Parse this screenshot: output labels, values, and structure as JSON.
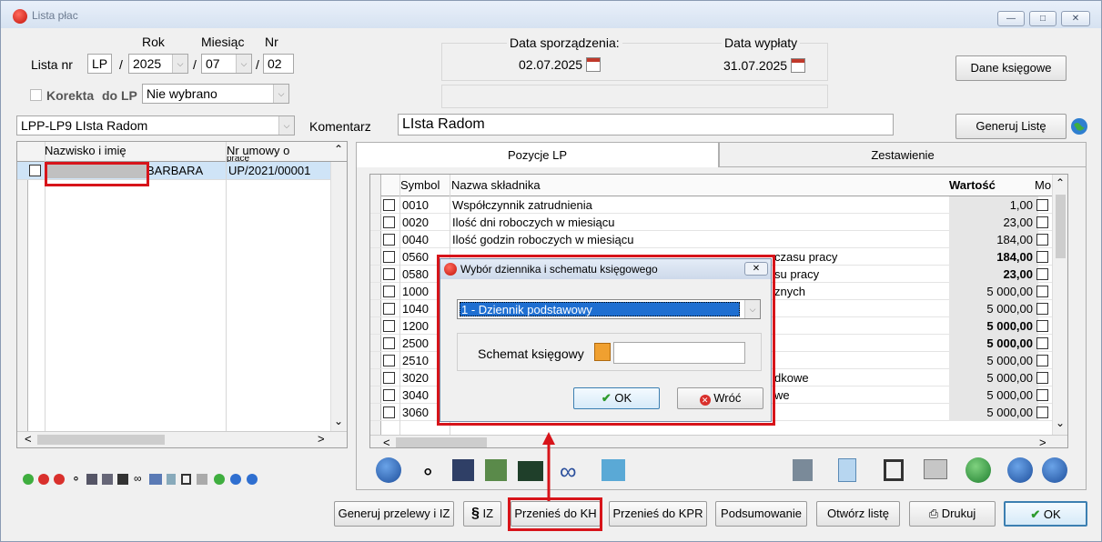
{
  "window": {
    "title": "Lista płac"
  },
  "header": {
    "lista_nr_label": "Lista nr",
    "lp_value": "LP",
    "sep": "/",
    "rok_label": "Rok",
    "rok_value": "2025",
    "miesiac_label": "Miesiąc",
    "miesiac_value": "07",
    "nr_label": "Nr",
    "nr_value": "02",
    "korekta_label": "Korekta",
    "do_lp_label": "do LP",
    "do_lp_value": "Nie wybrano",
    "data_sporzadzenia_label": "Data sporządzenia:",
    "data_sporzadzenia_value": "02.07.2025",
    "data_wyplaty_label": "Data wypłaty",
    "data_wyplaty_value": "31.07.2025",
    "dane_ksiegowe_button": "Dane księgowe",
    "schemat_value": "LPP-LP9 LIsta Radom",
    "komentarz_label": "Komentarz",
    "komentarz_value": "LIsta Radom",
    "generuj_liste_button": "Generuj Listę"
  },
  "left_grid": {
    "col_name": "Nazwisko i imię",
    "col_umowa": "Nr umowy o",
    "col_umowa_2": "pracę",
    "row": {
      "name": "BARBARA",
      "umowa": "UP/2021/00001"
    }
  },
  "tabs": [
    {
      "label": "Pozycje LP"
    },
    {
      "label": "Zestawienie"
    }
  ],
  "right_grid": {
    "col_symbol": "Symbol",
    "col_nazwa": "Nazwa składnika",
    "col_wartosc": "Wartość",
    "col_mo": "Mo",
    "rows": [
      {
        "symbol": "0010",
        "nazwa": "Współczynnik zatrudnienia",
        "wartosc": "1,00",
        "bold": false
      },
      {
        "symbol": "0020",
        "nazwa": "Ilość dni roboczych w miesiącu",
        "wartosc": "23,00",
        "bold": false
      },
      {
        "symbol": "0040",
        "nazwa": "Ilość godzin roboczych w miesiącu",
        "wartosc": "184,00",
        "bold": false
      },
      {
        "symbol": "0560",
        "nazwa": "czasu pracy",
        "wartosc": "184,00",
        "bold": true
      },
      {
        "symbol": "0580",
        "nazwa": "su pracy",
        "wartosc": "23,00",
        "bold": true
      },
      {
        "symbol": "1000",
        "nazwa": "znych",
        "wartosc": "5 000,00",
        "bold": false
      },
      {
        "symbol": "1040",
        "nazwa": "",
        "wartosc": "5 000,00",
        "bold": false
      },
      {
        "symbol": "1200",
        "nazwa": "",
        "wartosc": "5 000,00",
        "bold": true
      },
      {
        "symbol": "2500",
        "nazwa": "",
        "wartosc": "5 000,00",
        "bold": true
      },
      {
        "symbol": "2510",
        "nazwa": "",
        "wartosc": "5 000,00",
        "bold": false
      },
      {
        "symbol": "3020",
        "nazwa": "dkowe",
        "wartosc": "5 000,00",
        "bold": false
      },
      {
        "symbol": "3040",
        "nazwa": "we",
        "wartosc": "5 000,00",
        "bold": false
      },
      {
        "symbol": "3060",
        "nazwa": "",
        "wartosc": "5 000,00",
        "bold": false
      }
    ]
  },
  "dialog": {
    "title": "Wybór dziennika i schematu księgowego",
    "dziennik_value": "1 - Dziennik podstawowy",
    "schemat_label": "Schemat księgowy",
    "schemat_value": "",
    "ok_label": "OK",
    "cancel_label": "Wróć"
  },
  "bottom_buttons": {
    "generuj_przelewy": "Generuj przelewy i IZ",
    "iz": "IZ",
    "przenies_kh": "Przenieś do KH",
    "przenies_kpr": "Przenieś do KPR",
    "podsumowanie": "Podsumowanie",
    "otworz_liste": "Otwórz listę",
    "drukuj": "Drukuj",
    "ok": "OK"
  },
  "colors": {
    "highlight_red": "#d7141a",
    "selection_blue": "#1f6fd1",
    "row_select": "#cfe4f7"
  }
}
